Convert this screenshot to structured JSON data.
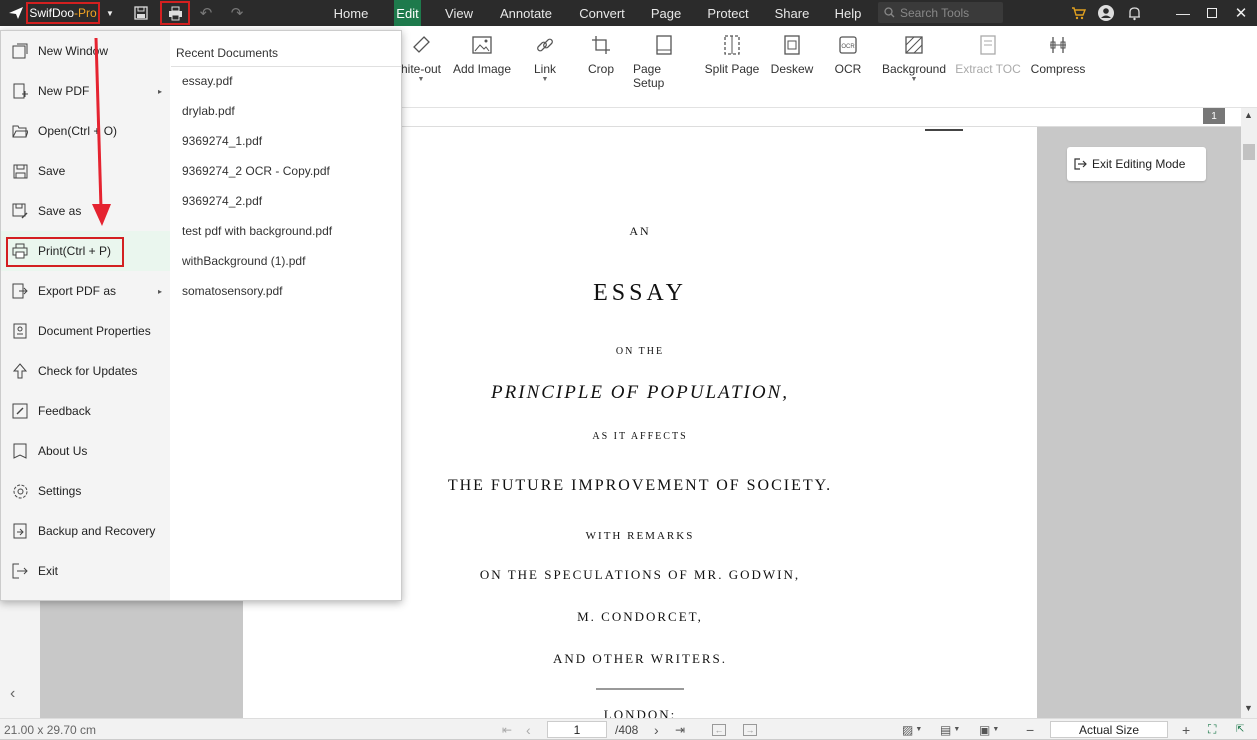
{
  "titlebar": {
    "brand": "SwifDoo",
    "brand_suffix": "-Pro",
    "tabs": [
      "Home",
      "Edit",
      "View",
      "Annotate",
      "Convert",
      "Page",
      "Protect",
      "Share",
      "Help"
    ],
    "active_tab": "Edit",
    "search_placeholder": "Search Tools"
  },
  "ribbon": {
    "items": [
      "hite-out",
      "Add Image",
      "Link",
      "Crop",
      "Page Setup",
      "Split Page",
      "Deskew",
      "OCR",
      "Background",
      "Extract TOC",
      "Compress"
    ]
  },
  "file_menu": {
    "items": [
      "New Window",
      "New PDF",
      "Open(Ctrl + O)",
      "Save",
      "Save as",
      "Print(Ctrl + P)",
      "Export PDF as",
      "Document Properties",
      "Check for Updates",
      "Feedback",
      "About Us",
      "Settings",
      "Backup and Recovery",
      "Exit"
    ],
    "recent_header": "Recent Documents",
    "recent": [
      "essay.pdf",
      "drylab.pdf",
      "9369274_1.pdf",
      "9369274_2 OCR - Copy.pdf",
      "9369274_2.pdf",
      "test pdf with background.pdf",
      "withBackground (1).pdf",
      "somatosensory.pdf"
    ]
  },
  "page_badge": "1",
  "exit_editing": "Exit Editing Mode",
  "document": {
    "l1": "AN",
    "l2": "ESSAY",
    "l3": "ON THE",
    "l4": "PRINCIPLE OF POPULATION,",
    "l5": "AS IT AFFECTS",
    "l6": "THE FUTURE IMPROVEMENT OF SOCIETY.",
    "l7": "WITH REMARKS",
    "l8": "ON THE SPECULATIONS OF MR. GODWIN,",
    "l9": "M. CONDORCET,",
    "l10": "AND OTHER WRITERS.",
    "l11": "LONDON:"
  },
  "status": {
    "page_size": "21.00 x 29.70 cm",
    "current_page": "1",
    "total_pages": "/408",
    "zoom": "Actual Size"
  },
  "colors": {
    "accent": "#1e7a4c",
    "highlight_box": "#d32020",
    "arrow": "#e52330",
    "brand_suffix": "#f5a623"
  }
}
